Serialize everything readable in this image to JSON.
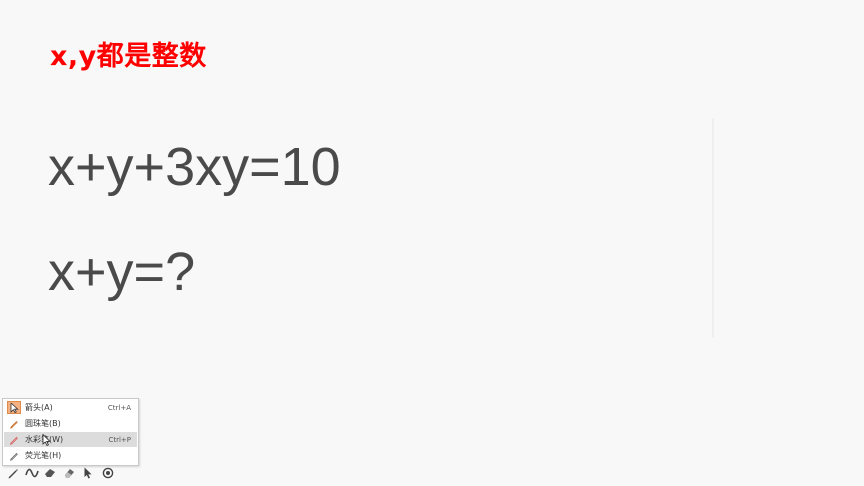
{
  "slide": {
    "title": "x,y都是整数",
    "equation_1": "x+y+3xy=10",
    "equation_2": "x+y=?"
  },
  "pen_menu": {
    "items": [
      {
        "label": "箭头(A)",
        "shortcut": "Ctrl+A",
        "icon": "arrow-cursor-icon",
        "selected": true
      },
      {
        "label": "圆珠笔(B)",
        "shortcut": "",
        "icon": "ballpoint-pen-icon"
      },
      {
        "label": "水彩笔(W)",
        "shortcut": "Ctrl+P",
        "icon": "felt-tip-pen-icon",
        "hovered": true
      },
      {
        "label": "荧光笔(H)",
        "shortcut": "",
        "icon": "highlighter-icon"
      }
    ]
  },
  "toolbar": {
    "buttons": [
      "pen-icon",
      "curve-icon",
      "eraser-brush-icon",
      "eraser-icon",
      "pointer-icon",
      "target-icon"
    ]
  },
  "colors": {
    "title": "#ff0000",
    "equation": "#4a4a4a",
    "selected_icon_bg": "#f4b183"
  }
}
